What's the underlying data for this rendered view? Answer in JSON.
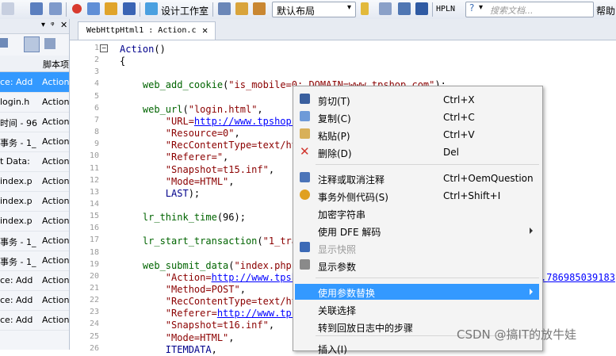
{
  "toolbar": {
    "design_studio": "设计工作室",
    "layout_value": "默认布局",
    "hpln": "HPLN",
    "search_placeholder": "搜索文档...",
    "help": "帮助"
  },
  "left_panel": {
    "column_header": "脚本项",
    "rows": [
      {
        "c1": "ce: Add",
        "c2": "Action"
      },
      {
        "c1": "login.h",
        "c2": "Action"
      },
      {
        "c1": "时间 - 96",
        "c2": "Action"
      },
      {
        "c1": "事务 - 1_",
        "c2": "Action"
      },
      {
        "c1": "t Data:",
        "c2": "Action"
      },
      {
        "c1": "index.p",
        "c2": "Action"
      },
      {
        "c1": "index.p",
        "c2": "Action"
      },
      {
        "c1": "index.p",
        "c2": "Action"
      },
      {
        "c1": "事务 - 1_",
        "c2": "Action"
      },
      {
        "c1": "事务 - 1_",
        "c2": "Action"
      },
      {
        "c1": "ce: Add",
        "c2": "Action"
      },
      {
        "c1": "ce: Add",
        "c2": "Action"
      },
      {
        "c1": "ce: Add",
        "c2": "Action"
      }
    ]
  },
  "editor": {
    "tab_title": "WebHttpHtml1 : Action.c",
    "line_numbers": [
      "1",
      "2",
      "3",
      "4",
      "5",
      "6",
      "7",
      "8",
      "9",
      "10",
      "11",
      "12",
      "13",
      "14",
      "15",
      "16",
      "17",
      "18",
      "19",
      "20",
      "21",
      "22",
      "23",
      "24",
      "25",
      "26"
    ],
    "lines": [
      "Action()",
      "{",
      "",
      "    web_add_cookie(\"is_mobile=0; DOMAIN=www.tpshop.com\");",
      "",
      "    web_url(\"login.html\",",
      "        \"URL=http://www.tpshop.",
      "        \"Resource=0\",",
      "        \"RecContentType=text/ht",
      "        \"Referer=\",",
      "        \"Snapshot=t15.inf\",",
      "        \"Mode=HTML\",",
      "        LAST);",
      "",
      "    lr_think_time(96);",
      "",
      "    lr_start_transaction(\"1_tra",
      "",
      "    web_submit_data(\"index.php\"",
      "        \"Action=http://www.tpsh",
      "        \"Method=POST\",",
      "        \"RecContentType=text/ht",
      "        \"Referer=http://www.tps",
      "        \"Snapshot=t16.inf\",",
      "        \"Mode=HTML\",",
      "        ITEMDATA,"
    ],
    "overflow_text": ".786985039183"
  },
  "context_menu": {
    "items": [
      {
        "label": "剪切(T)",
        "shortcut": "Ctrl+X",
        "icon": "scissors-icon"
      },
      {
        "label": "复制(C)",
        "shortcut": "Ctrl+C",
        "icon": "copy-icon"
      },
      {
        "label": "粘贴(P)",
        "shortcut": "Ctrl+V",
        "icon": "paste-icon"
      },
      {
        "label": "删除(D)",
        "shortcut": "Del",
        "icon": "delete-x-icon"
      },
      {
        "label": "注释或取消注释",
        "shortcut": "Ctrl+OemQuestion",
        "icon": "comment-icon"
      },
      {
        "label": "事务外侧代码(S)",
        "shortcut": "Ctrl+Shift+I",
        "icon": "clock-icon"
      },
      {
        "label": "加密字符串",
        "shortcut": "",
        "icon": ""
      },
      {
        "label": "使用 DFE 解码",
        "shortcut": "",
        "icon": ""
      },
      {
        "label": "显示快照",
        "shortcut": "",
        "icon": "snapshot-icon"
      },
      {
        "label": "显示参数",
        "shortcut": "",
        "icon": "parameter-icon"
      },
      {
        "label": "使用参数替换",
        "shortcut": "",
        "icon": ""
      },
      {
        "label": "关联选择",
        "shortcut": "",
        "icon": ""
      },
      {
        "label": "转到回放日志中的步骤",
        "shortcut": "",
        "icon": ""
      },
      {
        "label": "插入(I)",
        "shortcut": "",
        "icon": ""
      }
    ]
  },
  "watermark": "CSDN @搞IT的放牛娃",
  "colors": {
    "highlight": "#3399ff",
    "keyword": "#00008b",
    "function": "#006400",
    "string": "#8b0000",
    "link": "#0000ff"
  }
}
